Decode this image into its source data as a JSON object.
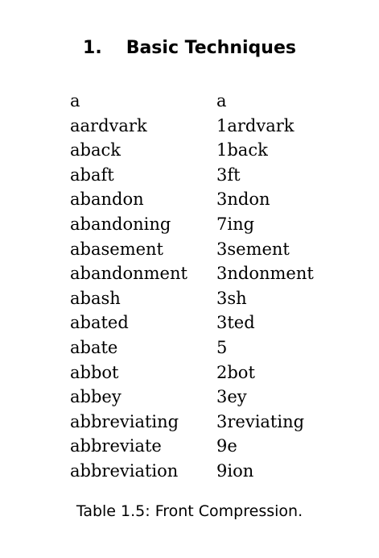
{
  "header": {
    "section_number": "1.",
    "section_title": "Basic Techniques"
  },
  "table": {
    "rows": [
      {
        "word": "a",
        "compressed": "a"
      },
      {
        "word": "aardvark",
        "compressed": "1ardvark"
      },
      {
        "word": "aback",
        "compressed": "1back"
      },
      {
        "word": "abaft",
        "compressed": "3ft"
      },
      {
        "word": "abandon",
        "compressed": "3ndon"
      },
      {
        "word": "abandoning",
        "compressed": "7ing"
      },
      {
        "word": "abasement",
        "compressed": "3sement"
      },
      {
        "word": "abandonment",
        "compressed": "3ndonment"
      },
      {
        "word": "abash",
        "compressed": "3sh"
      },
      {
        "word": "abated",
        "compressed": "3ted"
      },
      {
        "word": "abate",
        "compressed": "5"
      },
      {
        "word": "abbot",
        "compressed": "2bot"
      },
      {
        "word": "abbey",
        "compressed": "3ey"
      },
      {
        "word": "abbreviating",
        "compressed": "3reviating"
      },
      {
        "word": "abbreviate",
        "compressed": "9e"
      },
      {
        "word": "abbreviation",
        "compressed": "9ion"
      }
    ],
    "caption": "Table 1.5: Front Compression."
  }
}
